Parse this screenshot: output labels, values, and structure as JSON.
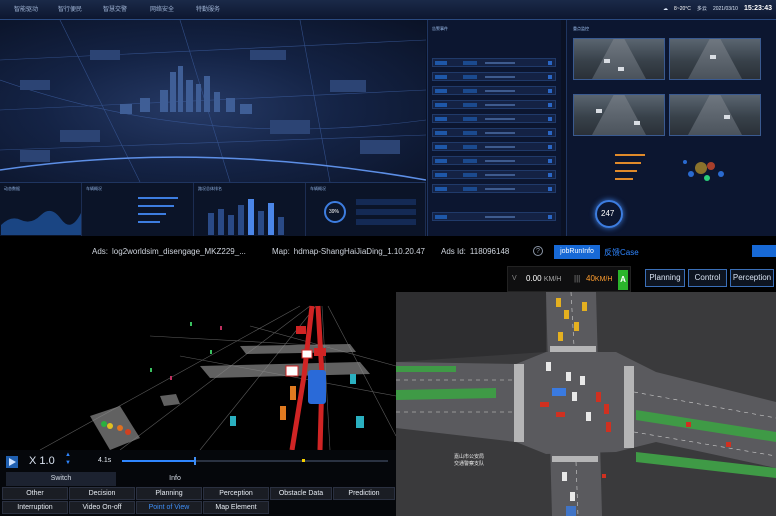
{
  "dashboard": {
    "nav": [
      "智能驱动",
      "智行便民",
      "智慧交警",
      "网络安全",
      "特勤服务"
    ],
    "weather": {
      "temp": "8~20°C",
      "cond": "多云",
      "date": "2021/03/10",
      "time": "15:23:43"
    },
    "bottom_panels": [
      "动态数据",
      "车辆概况",
      "路况总体排名",
      "车辆概况"
    ],
    "right_list_title": "告警事件",
    "camera_title": "重点监控",
    "gauge_value": "247",
    "ring_value": "39%"
  },
  "info_bar": {
    "ads_label": "Ads:",
    "ads_value": "log2worldsim_disengage_MKZ229_...",
    "map_label": "Map:",
    "map_value": "hdmap-ShangHaiJiaDing_1.10.20.47",
    "adsid_label": "Ads Id:",
    "adsid_value": "118096148",
    "help": "?",
    "job_button": "jobRunInfo",
    "feedback": "反馈Case"
  },
  "status": {
    "v_label": "V",
    "speed": "0.00",
    "speed_unit": "KM/H",
    "pipe": "|||",
    "limit": "40",
    "limit_unit": "KM/H",
    "gear": "A"
  },
  "modes": [
    "Planning",
    "Control",
    "Perception"
  ],
  "playback": {
    "rate": "X 1.0",
    "up": "▲",
    "down": "▼",
    "time": "4.1s",
    "progress": 0.27
  },
  "tabs": [
    "Switch",
    "Info"
  ],
  "buttons": {
    "row1": [
      "Other",
      "Decision",
      "Planning",
      "Perception",
      "Obstacle Data",
      "Prediction"
    ],
    "row2": [
      "Interruption",
      "Video On-off",
      "Point of View",
      "Map Element"
    ],
    "active": "Point of View"
  },
  "map": {
    "label_line1": "嘉山市公安局",
    "label_line2": "交通警察支队"
  },
  "colors": {
    "accent": "#1769d6",
    "link": "#2f86ff",
    "gear": "#2bb52b",
    "limit": "#ff9d2e"
  }
}
